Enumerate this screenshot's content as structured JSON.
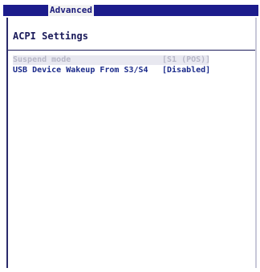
{
  "tabs": {
    "active": "Advanced"
  },
  "page": {
    "title": "ACPI Settings"
  },
  "settings": [
    {
      "label": "Suspend mode",
      "value": "[S1 (POS)]"
    },
    {
      "label": "USB Device Wakeup From S3/S4",
      "value": "[Disabled]"
    }
  ],
  "colors": {
    "tabbar_bg": "#1c1c8c",
    "text": "#1a2a8a",
    "selected_text": "#b8b8c8"
  }
}
